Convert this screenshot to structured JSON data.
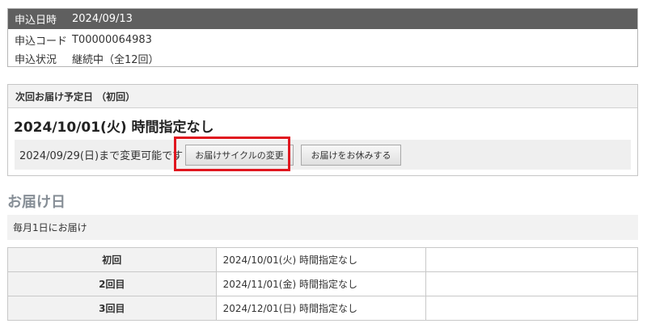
{
  "order": {
    "date_label": "申込日時",
    "date_value": "2024/09/13",
    "code_label": "申込コード",
    "code_value": "T00000064983",
    "status_label": "申込状況",
    "status_value": "継続中（全12回）"
  },
  "next_delivery": {
    "heading": "次回お届け予定日 （初回）",
    "date": "2024/10/01(火) 時間指定なし",
    "change_deadline": "2024/09/29(日)まで変更可能です",
    "change_cycle_button": "お届けサイクルの変更",
    "pause_button": "お届けをお休みする"
  },
  "delivery_section": {
    "title": "お届け日",
    "monthly_note": "毎月1日にお届け",
    "rows": [
      {
        "label": "初回",
        "value": "2024/10/01(火) 時間指定なし"
      },
      {
        "label": "2回目",
        "value": "2024/11/01(金) 時間指定なし"
      },
      {
        "label": "3回目",
        "value": "2024/12/01(日) 時間指定なし"
      }
    ]
  },
  "colors": {
    "header_bg": "#5f5f5f",
    "highlight": "#e0161f",
    "section_title": "#868e96"
  }
}
